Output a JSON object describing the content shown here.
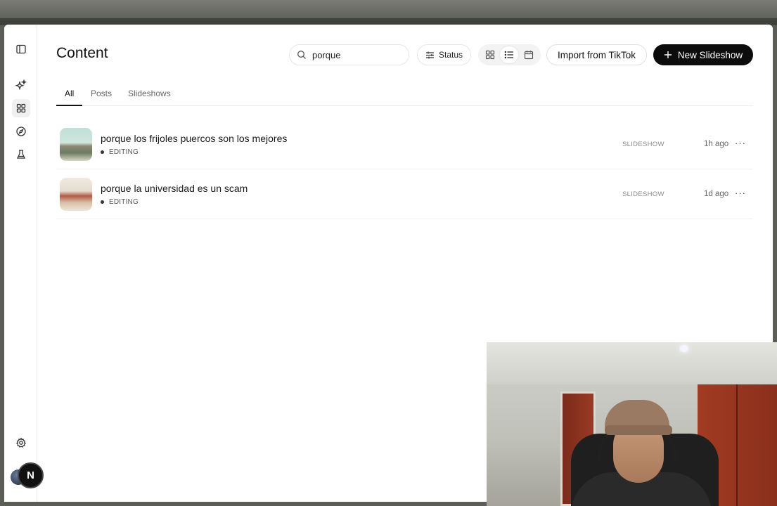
{
  "menubar": {
    "apple_icon": "apple-logo"
  },
  "sidebar": {
    "items": [
      {
        "name": "sidebar-toggle",
        "icon": "panel-left-icon"
      },
      {
        "name": "generate",
        "icon": "sparkles-icon"
      },
      {
        "name": "content",
        "icon": "grid-icon",
        "active": true
      },
      {
        "name": "explore",
        "icon": "compass-icon"
      },
      {
        "name": "lab",
        "icon": "flask-icon"
      },
      {
        "name": "settings",
        "icon": "gear-icon"
      }
    ],
    "badge_letter": "N"
  },
  "header": {
    "title": "Content",
    "search": {
      "value": "porque",
      "placeholder": ""
    },
    "status_label": "Status",
    "import_label": "Import from TikTok",
    "new_label": "New Slideshow"
  },
  "tabs": [
    {
      "label": "All",
      "active": true
    },
    {
      "label": "Posts",
      "active": false
    },
    {
      "label": "Slideshows",
      "active": false
    }
  ],
  "rows": [
    {
      "title": "porque los frijoles puercos son los mejores",
      "status": "EDITING",
      "type": "SLIDESHOW",
      "time": "1h ago"
    },
    {
      "title": "porque la universidad es un scam",
      "status": "EDITING",
      "type": "SLIDESHOW",
      "time": "1d ago"
    }
  ],
  "colors": {
    "primary_button": "#0c0c0c",
    "border": "#e6e6e6",
    "text_muted": "#888888"
  }
}
